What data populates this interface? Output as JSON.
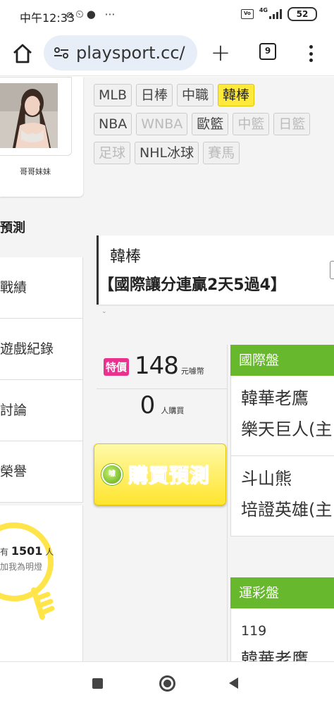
{
  "status_bar": {
    "time": "中午12:33",
    "left_icons": [
      "mute-icon",
      "alarm-icon",
      "chat-icon",
      "more-dots-icon"
    ],
    "left_glyphs": "⌀⏲● ⋯",
    "volte": "VoLTE",
    "network": "4G",
    "battery": "52"
  },
  "browser": {
    "url": "playsport.cc/",
    "tab_count": "9"
  },
  "sidebar": {
    "profile_name": "哥哥妹妹",
    "section_title": "預測",
    "nav_items": [
      "戰績",
      "遊戲紀錄",
      "討論",
      "榮譽"
    ],
    "fans": {
      "prefix": "有",
      "count": "1501",
      "unit": "人",
      "subtitle": "加我為明燈"
    }
  },
  "categories": {
    "row1": [
      {
        "label": "MLB",
        "state": "normal"
      },
      {
        "label": "日棒",
        "state": "normal"
      },
      {
        "label": "中職",
        "state": "normal"
      },
      {
        "label": "韓棒",
        "state": "active"
      }
    ],
    "row2": [
      {
        "label": "NBA",
        "state": "normal"
      },
      {
        "label": "WNBA",
        "state": "dim"
      },
      {
        "label": "歐籃",
        "state": "normal"
      },
      {
        "label": "中籃",
        "state": "dim"
      },
      {
        "label": "日籃",
        "state": "dim"
      }
    ],
    "row3": [
      {
        "label": "足球",
        "state": "dim"
      },
      {
        "label": "NHL冰球",
        "state": "normal"
      },
      {
        "label": "賽馬",
        "state": "dim"
      }
    ]
  },
  "prediction": {
    "league": "韓棒",
    "title": "【國際讓分連贏2天5過4】"
  },
  "pricing": {
    "badge": "特價",
    "price": "148",
    "price_unit": "元噱幣",
    "buyers": "0",
    "buyers_unit": "人購買",
    "coin_label": "噱",
    "buy_button": "購買預測"
  },
  "games": {
    "intl_market": "國際盤",
    "matches": [
      {
        "team1": "韓華老鷹",
        "team2": "樂天巨人(主"
      },
      {
        "team1": "斗山熊",
        "team2": "培證英雄(主"
      }
    ],
    "lottery_market": "運彩盤",
    "lottery_number": "119",
    "lottery_team_partial": "韓華老鷹"
  },
  "colors": {
    "accent_green": "#67b82d",
    "active_tag": "#ffe93c",
    "special_badge": "#e8328e",
    "buy_text": "#e42b8c"
  }
}
